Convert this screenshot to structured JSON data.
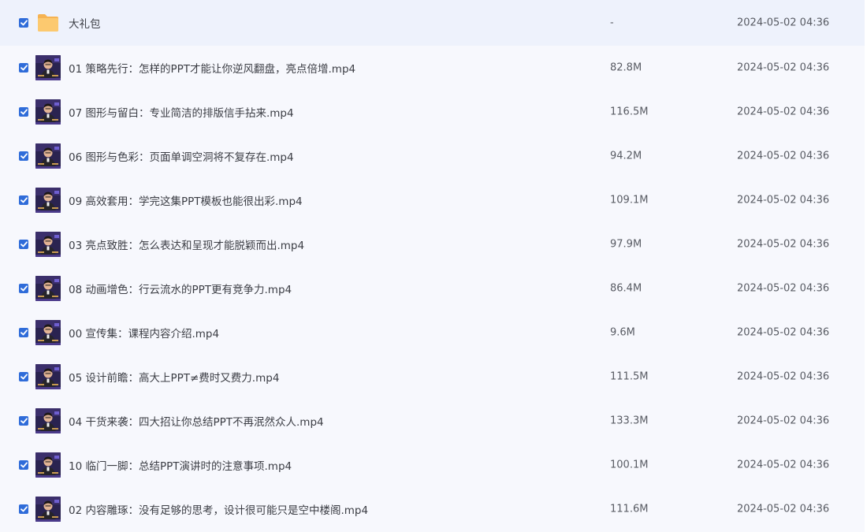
{
  "files": [
    {
      "type": "folder",
      "name": "大礼包",
      "size": "-",
      "modified": "2024-05-02 04:36",
      "checked": true
    },
    {
      "type": "video",
      "name": "01 策略先行：怎样的PPT才能让你逆风翻盘，亮点倍增.mp4",
      "size": "82.8M",
      "modified": "2024-05-02 04:36",
      "checked": true
    },
    {
      "type": "video",
      "name": "07 图形与留白：专业简洁的排版信手拈来.mp4",
      "size": "116.5M",
      "modified": "2024-05-02 04:36",
      "checked": true
    },
    {
      "type": "video",
      "name": "06 图形与色彩：页面单调空洞将不复存在.mp4",
      "size": "94.2M",
      "modified": "2024-05-02 04:36",
      "checked": true
    },
    {
      "type": "video",
      "name": "09 高效套用：学完这集PPT模板也能很出彩.mp4",
      "size": "109.1M",
      "modified": "2024-05-02 04:36",
      "checked": true
    },
    {
      "type": "video",
      "name": "03 亮点致胜：怎么表达和呈现才能脱颖而出.mp4",
      "size": "97.9M",
      "modified": "2024-05-02 04:36",
      "checked": true
    },
    {
      "type": "video",
      "name": "08 动画增色：行云流水的PPT更有竞争力.mp4",
      "size": "86.4M",
      "modified": "2024-05-02 04:36",
      "checked": true
    },
    {
      "type": "video",
      "name": "00 宣传集：课程内容介绍.mp4",
      "size": "9.6M",
      "modified": "2024-05-02 04:36",
      "checked": true
    },
    {
      "type": "video",
      "name": "05 设计前瞻：高大上PPT≠费时又费力.mp4",
      "size": "111.5M",
      "modified": "2024-05-02 04:36",
      "checked": true
    },
    {
      "type": "video",
      "name": "04 干货来袭：四大招让你总结PPT不再泯然众人.mp4",
      "size": "133.3M",
      "modified": "2024-05-02 04:36",
      "checked": true
    },
    {
      "type": "video",
      "name": "10 临门一脚：总结PPT演讲时的注意事项.mp4",
      "size": "100.1M",
      "modified": "2024-05-02 04:36",
      "checked": true
    },
    {
      "type": "video",
      "name": "02 内容雕琢：没有足够的思考，设计很可能只是空中楼阁.mp4",
      "size": "111.6M",
      "modified": "2024-05-02 04:36",
      "checked": true
    }
  ],
  "icons": {
    "checkbox": "checked-checkbox-icon",
    "folder": "folder-icon",
    "video": "video-thumbnail"
  },
  "colors": {
    "accent": "#2f6cd9",
    "folder": "#fbc56a",
    "row_background": "#f7f8fd"
  }
}
